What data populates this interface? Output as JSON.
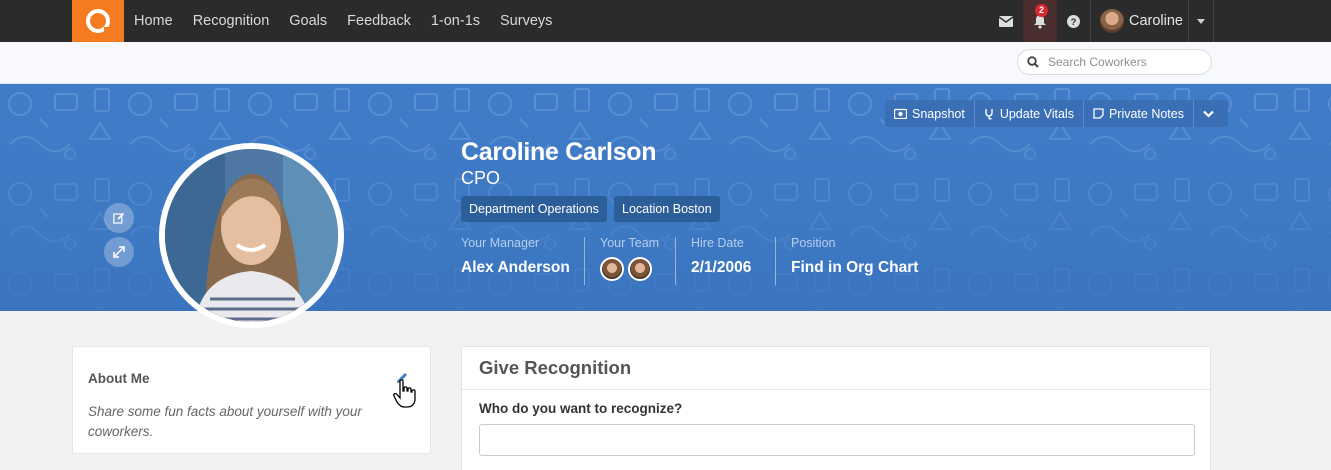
{
  "nav": {
    "links": [
      "Home",
      "Recognition",
      "Goals",
      "Feedback",
      "1-on-1s",
      "Surveys"
    ],
    "notification_count": "2",
    "user_name": "Caroline"
  },
  "search": {
    "placeholder": "Search Coworkers"
  },
  "toolbar": {
    "snapshot": "Snapshot",
    "update_vitals": "Update Vitals",
    "private_notes": "Private Notes"
  },
  "profile": {
    "name": "Caroline Carlson",
    "title": "CPO",
    "tags": [
      "Department Operations",
      "Location Boston"
    ],
    "manager_label": "Your Manager",
    "manager_value": "Alex Anderson",
    "team_label": "Your Team",
    "hire_label": "Hire Date",
    "hire_value": "2/1/2006",
    "position_label": "Position",
    "position_value": "Find in Org Chart"
  },
  "about": {
    "title": "About Me",
    "text": "Share some fun facts about yourself with your coworkers."
  },
  "recognition": {
    "title": "Give Recognition",
    "question": "Who do you want to recognize?"
  },
  "colors": {
    "navbar": "#2b2b2b",
    "brand_orange": "#f47b20",
    "banner_blue": "#3f7bc6",
    "tag_blue": "#2c5f99",
    "badge_red": "#d9272e"
  }
}
